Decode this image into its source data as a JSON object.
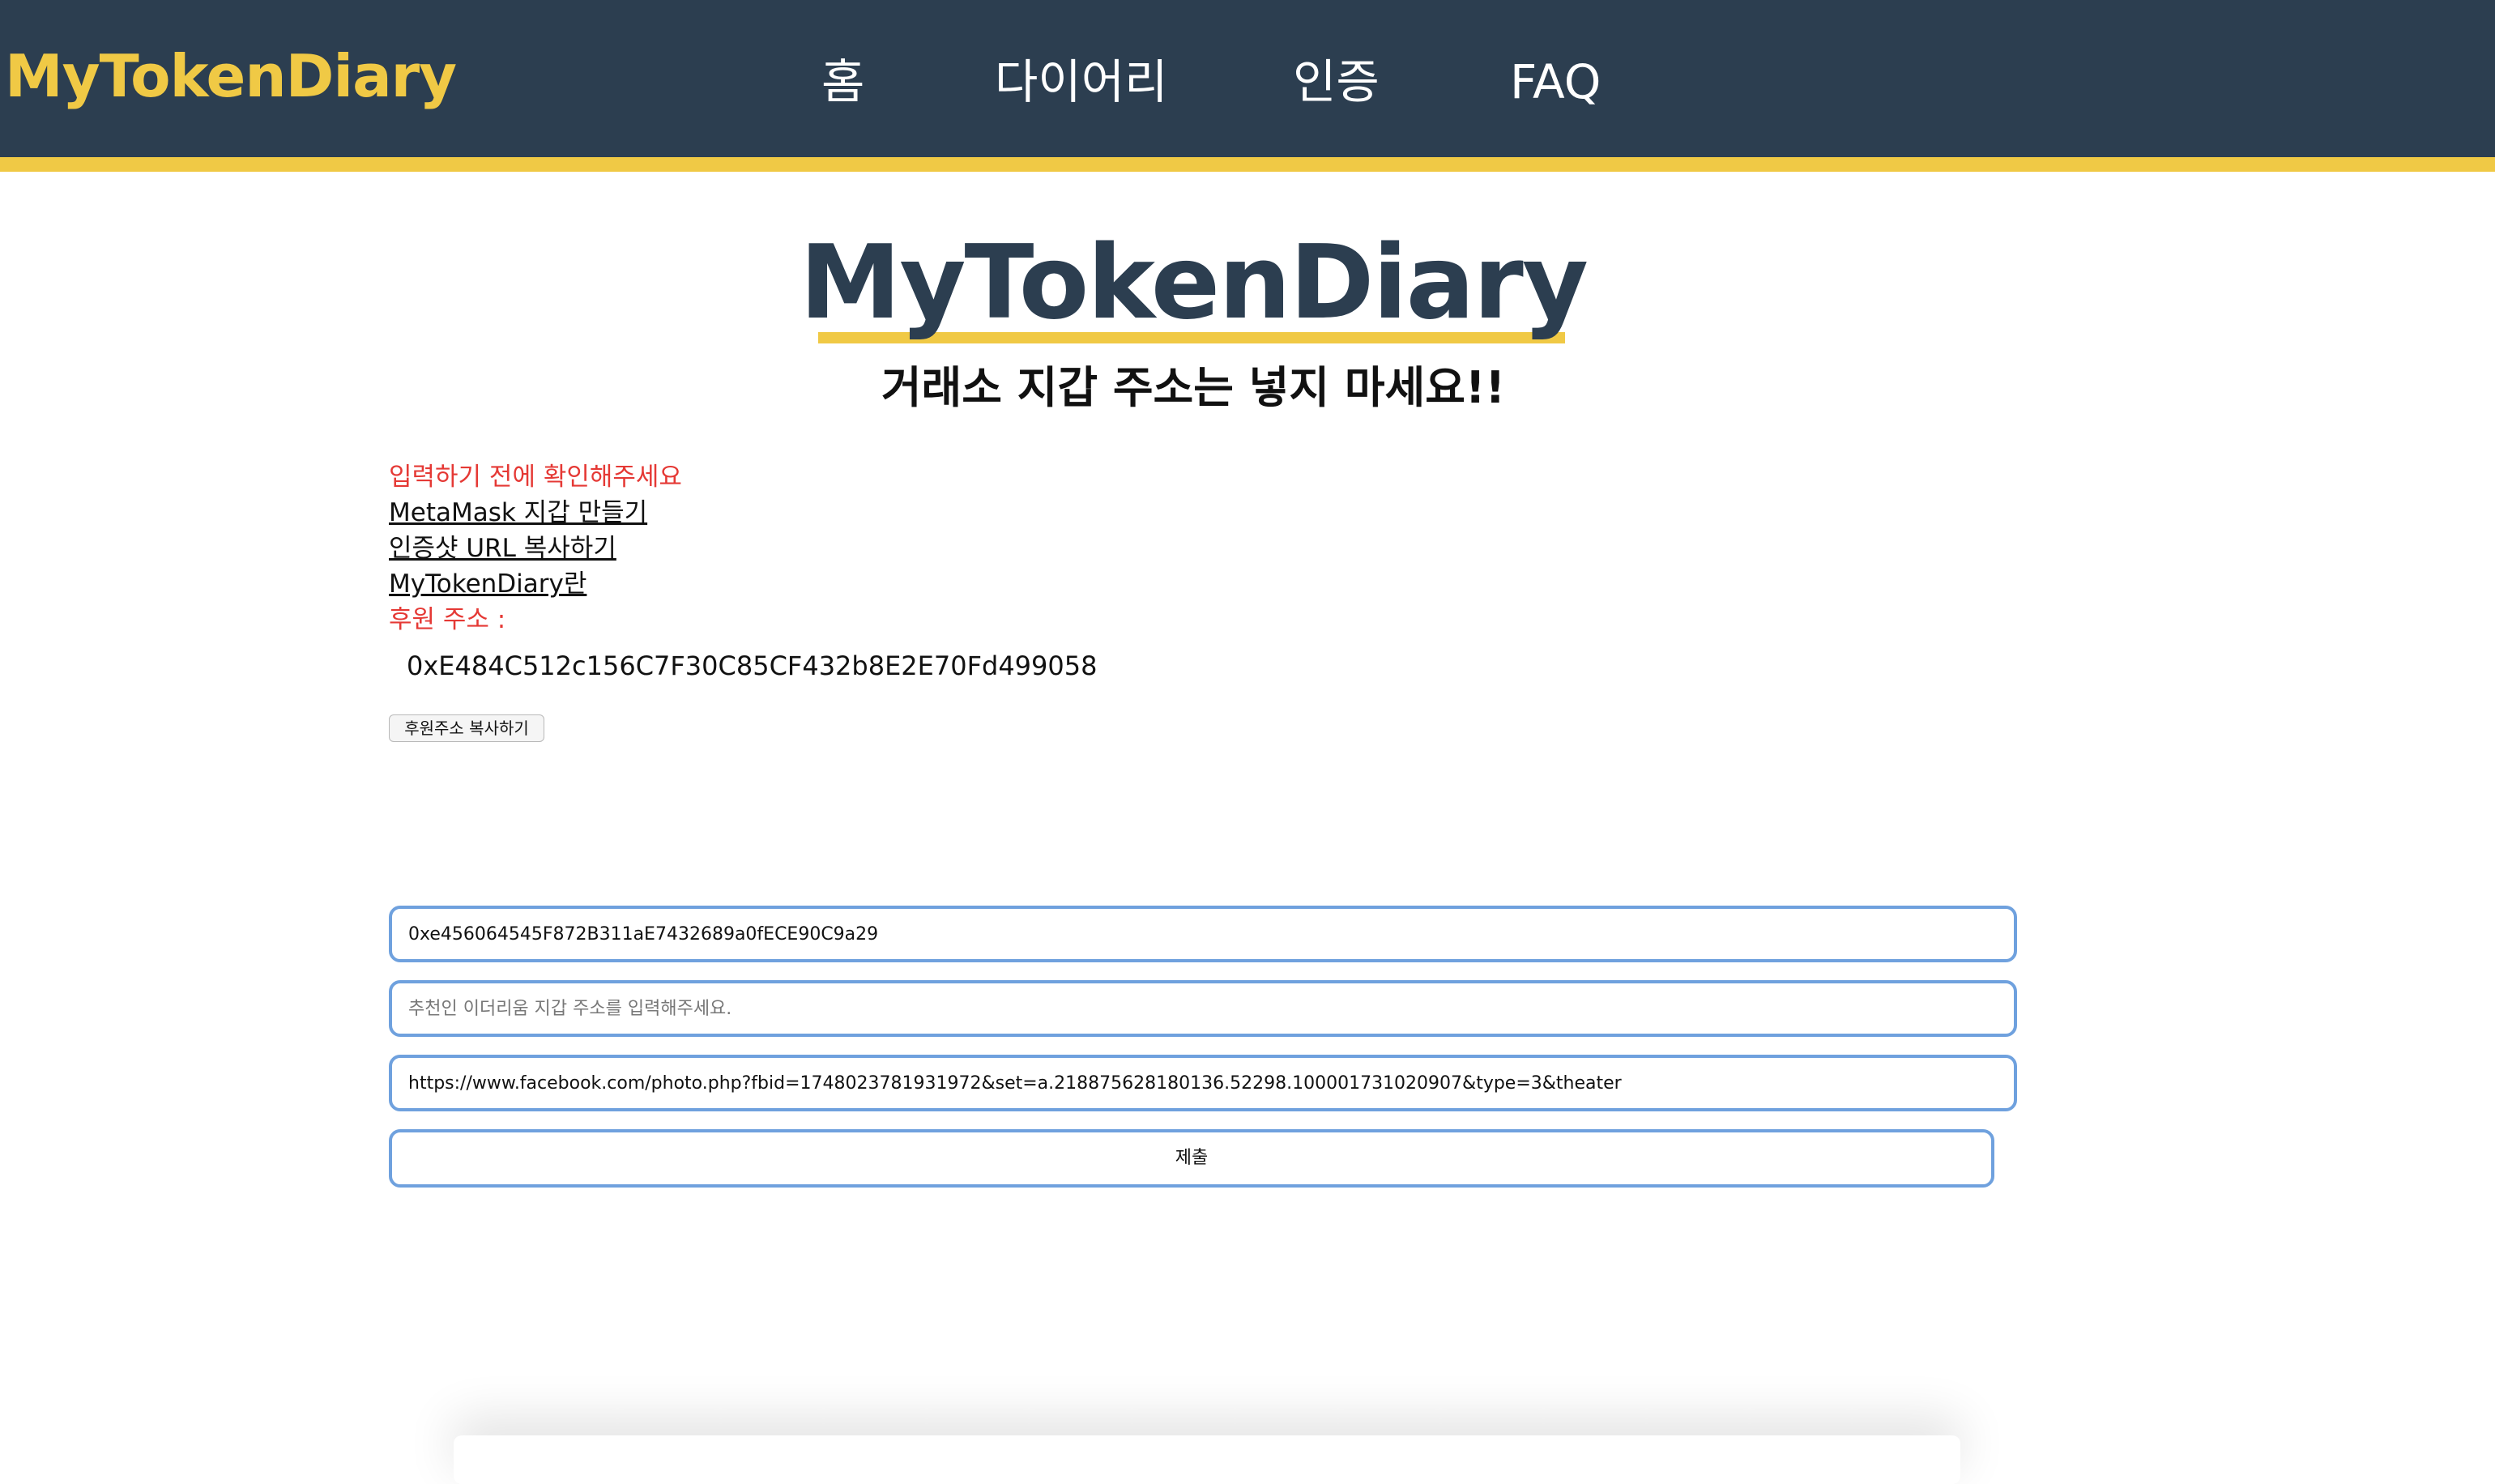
{
  "header": {
    "brand": "MyTokenDiary",
    "nav": {
      "home": "홈",
      "diary": "다이어리",
      "auth": "인증",
      "faq": "FAQ"
    }
  },
  "hero": {
    "title": "MyTokenDiary",
    "subtitle": "거래소 지갑 주소는 넣지 마세요!!"
  },
  "info": {
    "notice": "입력하기 전에 확인해주세요",
    "link_metamask": "MetaMask 지갑 만들기",
    "link_copy_url": "인증샷 URL 복사하기",
    "link_about": "MyTokenDiary란",
    "donation_label": "후원 주소 :",
    "donation_address": "0xE484C512c156C7F30C85CF432b8E2E70Fd499058",
    "copy_button": "후원주소 복사하기"
  },
  "form": {
    "wallet_value": "0xe456064545F872B311aE7432689a0fECE90C9a29",
    "referrer_value": "",
    "referrer_placeholder": "추천인 이더리움 지갑 주소를 입력해주세요.",
    "url_value": "https://www.facebook.com/photo.php?fbid=1748023781931972&set=a.218875628180136.52298.100001731020907&type=3&theater",
    "submit_label": "제출"
  },
  "colors": {
    "header_bg": "#2c3e50",
    "accent": "#f0c945",
    "warning": "#e53935",
    "field_border": "#6fa1de"
  }
}
